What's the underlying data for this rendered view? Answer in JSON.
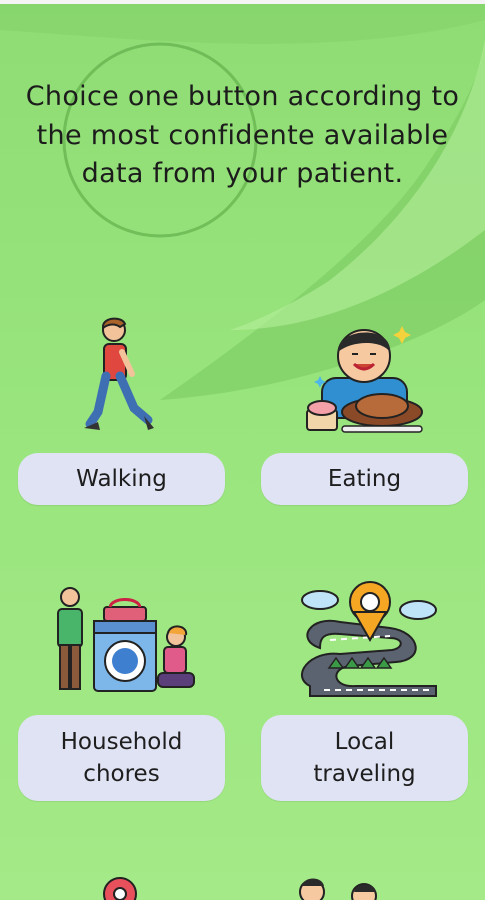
{
  "header": {
    "instruction": "Choice one button according to the most confidente available data from your patient."
  },
  "options": [
    {
      "label": "Walking",
      "icon": "walking-person-icon"
    },
    {
      "label": "Eating",
      "icon": "eating-person-icon"
    },
    {
      "label": "Household\nchores",
      "icon": "household-chores-icon"
    },
    {
      "label": "Local\ntraveling",
      "icon": "local-traveling-map-icon"
    }
  ],
  "colors": {
    "background": "#9be57f",
    "button_bg": "#dfe3f3",
    "text": "#1c1c1c"
  }
}
